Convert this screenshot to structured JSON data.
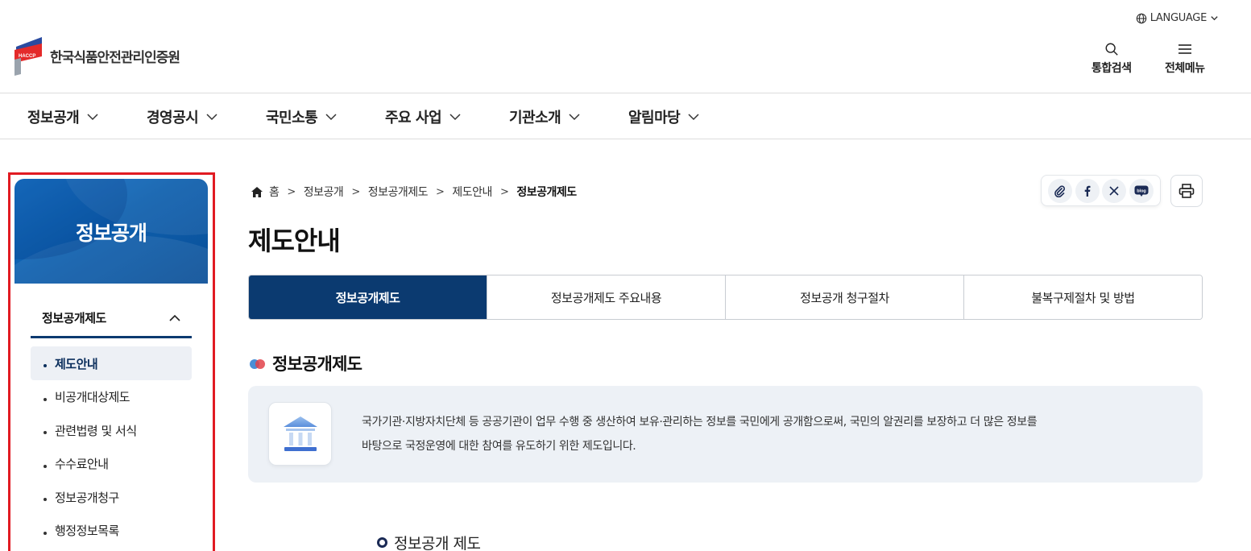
{
  "header": {
    "language_label": "LANGUAGE",
    "logo_badge": "HACCP",
    "org_name": "한국식품안전관리인증원",
    "search_label": "통합검색",
    "menu_label": "전체메뉴"
  },
  "gnb": [
    {
      "label": "정보공개"
    },
    {
      "label": "경영공시"
    },
    {
      "label": "국민소통"
    },
    {
      "label": "주요 사업"
    },
    {
      "label": "기관소개"
    },
    {
      "label": "알림마당"
    }
  ],
  "sidebar": {
    "banner_title": "정보공개",
    "section_title": "정보공개제도",
    "items": [
      {
        "label": "제도안내",
        "active": true
      },
      {
        "label": "비공개대상제도"
      },
      {
        "label": "관련법령 및 서식"
      },
      {
        "label": "수수료안내"
      },
      {
        "label": "정보공개청구"
      },
      {
        "label": "행정정보목록"
      }
    ]
  },
  "breadcrumb": {
    "home": "홈",
    "items": [
      "정보공개",
      "정보공개제도",
      "제도안내"
    ],
    "current": "정보공개제도"
  },
  "share": {
    "icons": [
      "link-icon",
      "facebook-icon",
      "x-icon",
      "blog-icon"
    ],
    "blog_text": "blog"
  },
  "page_title": "제도안내",
  "tabs": [
    {
      "label": "정보공개제도",
      "active": true
    },
    {
      "label": "정보공개제도 주요내용"
    },
    {
      "label": "정보공개 청구절차"
    },
    {
      "label": "불복구제절차 및 방법"
    }
  ],
  "section": {
    "title": "정보공개제도",
    "description_line1": "국가기관·지방자치단체 등 공공기관이 업무 수행 중 생산하여 보유·관리하는 정보를 국민에게 공개함으로써, 국민의 알권리를 보장하고 더 많은 정보를",
    "description_line2": "바탕으로 국정운영에 대한 참여를 유도하기 위한 제도입니다.",
    "sub_heading": "정보공개 제도"
  },
  "colors": {
    "primary_navy": "#0b3a70",
    "highlight_red": "#e11b22",
    "info_bg": "#edf1f6"
  }
}
